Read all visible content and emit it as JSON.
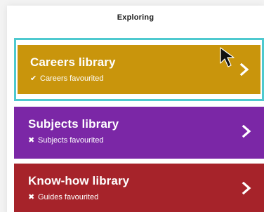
{
  "header": {
    "title": "Exploring"
  },
  "colors": {
    "careers": "#c9950c",
    "subjects": "#7b27a6",
    "knowhow": "#a6232a",
    "focus_ring": "#4ec9cf"
  },
  "cards": [
    {
      "key": "careers",
      "label": "Careers library",
      "status": "Careers favourited",
      "status_icon": "✔",
      "status_icon_name": "check-icon"
    },
    {
      "key": "subjects",
      "label": "Subjects library",
      "status": "Subjects favourited",
      "status_icon": "✖",
      "status_icon_name": "cross-icon"
    },
    {
      "key": "knowhow",
      "label": "Know-how library",
      "status": "Guides favourited",
      "status_icon": "✖",
      "status_icon_name": "cross-icon"
    }
  ]
}
